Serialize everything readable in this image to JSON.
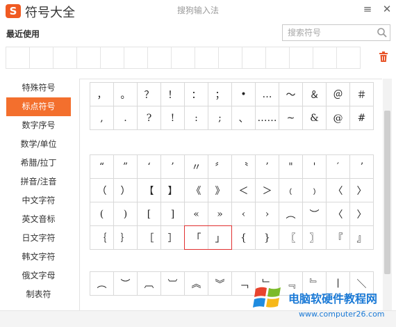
{
  "app": {
    "logo_char": "S",
    "title": "符号大全",
    "brand_subtitle": "搜狗输入法"
  },
  "window_controls": {
    "menu": "≡",
    "close": "✕"
  },
  "recent": {
    "label": "最近使用",
    "slots": 15
  },
  "search": {
    "placeholder": "搜索符号",
    "value": ""
  },
  "sidebar": {
    "items": [
      {
        "label": "特殊符号",
        "active": false
      },
      {
        "label": "标点符号",
        "active": true
      },
      {
        "label": "数字序号",
        "active": false
      },
      {
        "label": "数学/单位",
        "active": false
      },
      {
        "label": "希腊/拉丁",
        "active": false
      },
      {
        "label": "拼音/注音",
        "active": false
      },
      {
        "label": "中文字符",
        "active": false
      },
      {
        "label": "英文音标",
        "active": false
      },
      {
        "label": "日文字符",
        "active": false
      },
      {
        "label": "韩文字符",
        "active": false
      },
      {
        "label": "俄文字母",
        "active": false
      },
      {
        "label": "制表符",
        "active": false
      }
    ]
  },
  "symbol_blocks": [
    {
      "rows": [
        [
          "，",
          "。",
          "？",
          "！",
          "：",
          "；",
          "•",
          "…",
          "～",
          "＆",
          "＠",
          "＃"
        ],
        [
          ",",
          ".",
          "?",
          "!",
          ":",
          ";",
          "、",
          "……",
          "~",
          "&",
          "@",
          "#"
        ]
      ]
    },
    {
      "rows": [
        [
          "“",
          "”",
          "‘",
          "’",
          "〃",
          "〞",
          "〝",
          "’",
          "\"",
          "'",
          "′",
          "ʼ"
        ],
        [
          "（",
          "）",
          "【",
          "】",
          "《",
          "》",
          "＜",
          "＞",
          "﹙",
          "﹚",
          "〈",
          "〉"
        ],
        [
          "(",
          ")",
          "[",
          "]",
          "«",
          "»",
          "‹",
          "›",
          "︵",
          "︶",
          "〈",
          "〉"
        ],
        [
          "｛",
          "｝",
          "［",
          "］",
          "「",
          "」",
          "{",
          "}",
          "〖",
          "〗",
          "『",
          "』"
        ]
      ],
      "selected": [
        [
          3,
          4
        ],
        [
          3,
          5
        ]
      ]
    },
    {
      "rows": [
        [
          "︵",
          "︶",
          "︹",
          "︺",
          "︽",
          "︾",
          "﹁",
          "﹂",
          "﹃",
          "﹄",
          "∣",
          "＼"
        ]
      ]
    }
  ],
  "watermark": {
    "title": "电脑软硬件教程网",
    "url": "www.computer26.com"
  },
  "colors": {
    "accent": "#f36f2d",
    "logo": "#f05a22",
    "selection": "#e03030",
    "watermark": "#1b7ad6"
  }
}
